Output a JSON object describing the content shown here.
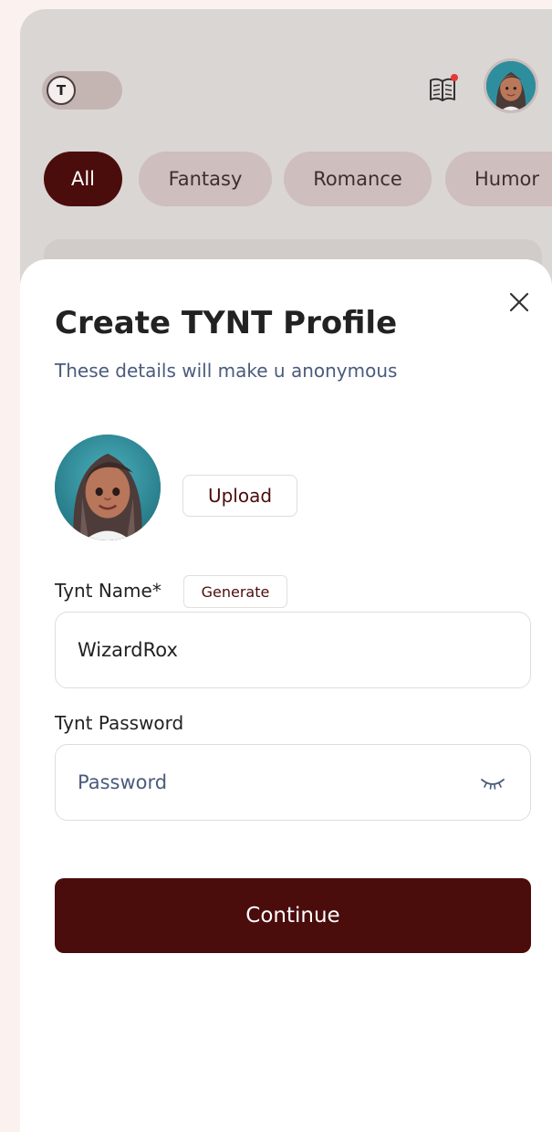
{
  "topbar": {
    "toggle_letter": "T",
    "book_icon": "book-icon",
    "notification_dot_color": "#e53935",
    "avatar_icon": "avatar"
  },
  "categories": [
    {
      "label": "All",
      "active": true
    },
    {
      "label": "Fantasy",
      "active": false
    },
    {
      "label": "Romance",
      "active": false
    },
    {
      "label": "Humor",
      "active": false
    }
  ],
  "sheet": {
    "title": "Create TYNT Profile",
    "subtitle": "These details will make u anonymous",
    "upload_label": "Upload",
    "name_label": "Tynt Name*",
    "generate_label": "Generate",
    "name_value": "WizardRox",
    "password_label": "Tynt Password",
    "password_placeholder": "Password",
    "continue_label": "Continue",
    "close_icon": "close-icon",
    "eye_icon": "eye-closed-icon"
  },
  "colors": {
    "brand": "#4b0c0c",
    "background": "#dad6d4",
    "pill": "#cfbebe",
    "subtitle": "#4a5b7c"
  }
}
